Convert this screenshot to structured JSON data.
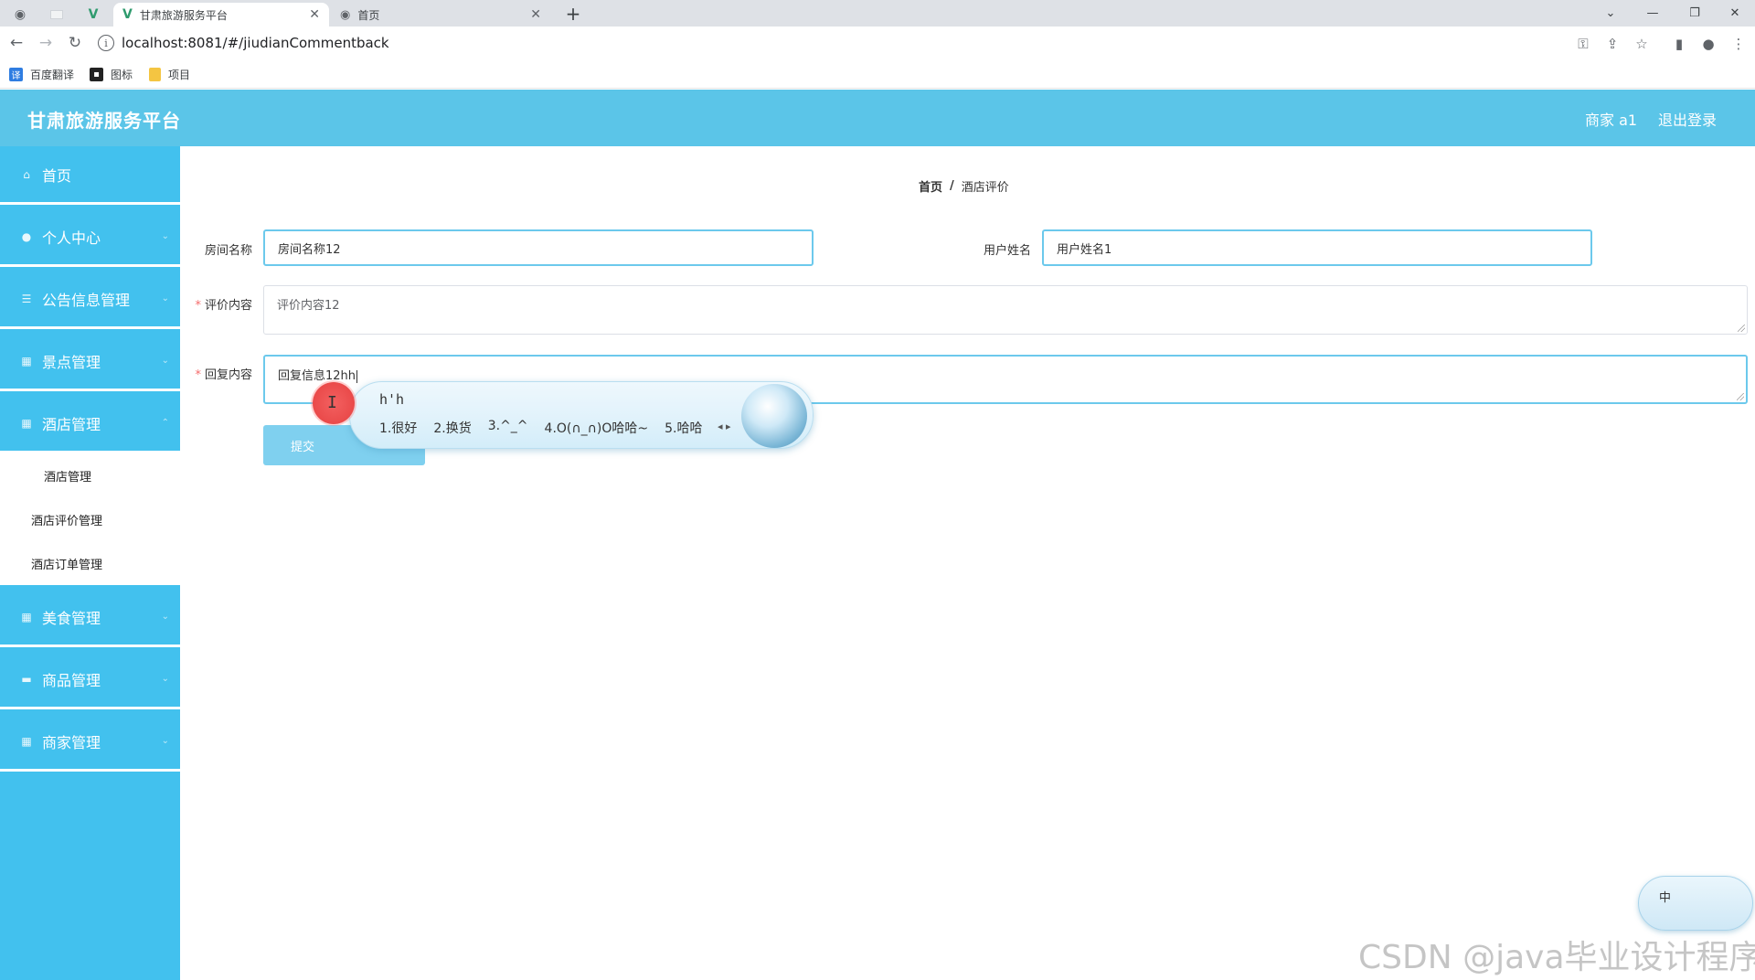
{
  "browser": {
    "tabs": [
      {
        "title": "甘肃旅游服务平台",
        "active": true
      },
      {
        "title": "首页",
        "active": false
      }
    ],
    "url": "localhost:8081/#/jiudianCommentback",
    "bookmarks": [
      {
        "label": "百度翻译",
        "icon": "translate-icon"
      },
      {
        "label": "图标",
        "icon": "image-icon"
      },
      {
        "label": "项目",
        "icon": "folder-icon"
      }
    ]
  },
  "header": {
    "title": "甘肃旅游服务平台",
    "user": "商家 a1",
    "logout": "退出登录"
  },
  "sidebar": {
    "items": [
      {
        "label": "首页",
        "icon": "home-icon"
      },
      {
        "label": "个人中心",
        "icon": "user-icon"
      },
      {
        "label": "公告信息管理",
        "icon": "list-icon"
      },
      {
        "label": "景点管理",
        "icon": "grid-icon"
      },
      {
        "label": "酒店管理",
        "icon": "grid-icon"
      },
      {
        "label": "美食管理",
        "icon": "grid-icon"
      },
      {
        "label": "商品管理",
        "icon": "chat-icon"
      },
      {
        "label": "商家管理",
        "icon": "grid-icon"
      }
    ],
    "submenu": [
      "酒店管理",
      "酒店评价管理",
      "酒店订单管理"
    ]
  },
  "breadcrumb": {
    "home": "首页",
    "sep": "/",
    "current": "酒店评价"
  },
  "form": {
    "room_label": "房间名称",
    "room_value": "房间名称12",
    "user_label": "用户姓名",
    "user_value": "用户姓名1",
    "required_mark": "*",
    "comment_label": "评价内容",
    "comment_value": "评价内容12",
    "reply_label": "回复内容",
    "reply_value": "回复信息12hh",
    "submit": "提交"
  },
  "ime": {
    "composition": "h'h",
    "candidates": [
      "1.很好",
      "2.换货",
      "3.^_^",
      "4.O(∩_∩)O哈哈~",
      "5.哈哈"
    ],
    "status": "中"
  },
  "watermark": "CSDN @java毕业设计程序"
}
